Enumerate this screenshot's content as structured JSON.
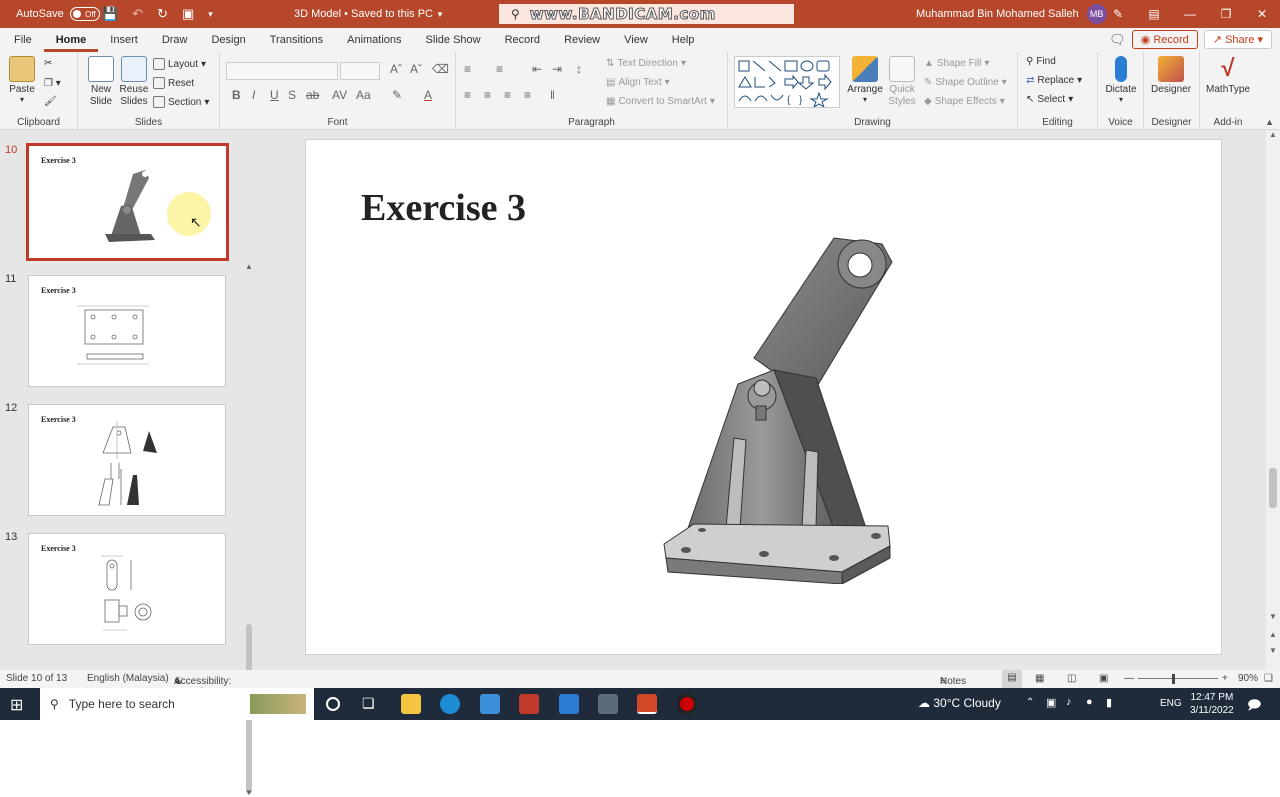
{
  "titlebar": {
    "autosave_label": "AutoSave",
    "autosave_state": "Off",
    "doc_title": "3D Model • Saved to this PC",
    "search_watermark": "www.BANDICAM.com",
    "user_name": "Muhammad Bin Mohamed Salleh",
    "user_initials": "MB"
  },
  "tabs": [
    "File",
    "Home",
    "Insert",
    "Draw",
    "Design",
    "Transitions",
    "Animations",
    "Slide Show",
    "Record",
    "Review",
    "View",
    "Help"
  ],
  "tab_right": {
    "record": "Record",
    "share": "Share"
  },
  "ribbon": {
    "clipboard": {
      "label": "Clipboard",
      "paste": "Paste"
    },
    "slides": {
      "label": "Slides",
      "new_slide": "New Slide",
      "reuse_slides": "Reuse Slides",
      "layout": "Layout",
      "reset": "Reset",
      "section": "Section"
    },
    "font": {
      "label": "Font",
      "bold": "B",
      "italic": "I",
      "underline": "U",
      "strike": "S",
      "strike2": "ab",
      "spacing": "AV",
      "case": "Aa"
    },
    "paragraph": {
      "label": "Paragraph",
      "text_direction": "Text Direction",
      "align_text": "Align Text",
      "convert_smartart": "Convert to SmartArt"
    },
    "drawing": {
      "label": "Drawing",
      "arrange": "Arrange",
      "quick_styles": "Quick Styles",
      "shape_fill": "Shape Fill",
      "shape_outline": "Shape Outline",
      "shape_effects": "Shape Effects"
    },
    "editing": {
      "label": "Editing",
      "find": "Find",
      "replace": "Replace",
      "select": "Select"
    },
    "voice": {
      "label": "Voice",
      "dictate": "Dictate"
    },
    "designer": {
      "label": "Designer",
      "designer": "Designer"
    },
    "addin": {
      "label": "Add-in",
      "mathtype": "MathType"
    }
  },
  "slides": [
    {
      "number": "10",
      "title": "Exercise 3"
    },
    {
      "number": "11",
      "title": "Exercise 3"
    },
    {
      "number": "12",
      "title": "Exercise 3"
    },
    {
      "number": "13",
      "title": "Exercise 3"
    }
  ],
  "main_slide": {
    "title": "Exercise 3"
  },
  "statusbar": {
    "slide_info": "Slide 10 of 13",
    "language": "English (Malaysia)",
    "accessibility": "Accessibility: Investigate",
    "notes": "Notes",
    "zoom": "90%"
  },
  "taskbar": {
    "search_placeholder": "Type here to search",
    "weather": "30°C  Cloudy",
    "lang": "ENG",
    "time": "12:47 PM",
    "date": "3/11/2022"
  },
  "colors": {
    "accent": "#b7472a",
    "selected_border": "#c0392b",
    "taskbar": "#1f2b3a"
  }
}
